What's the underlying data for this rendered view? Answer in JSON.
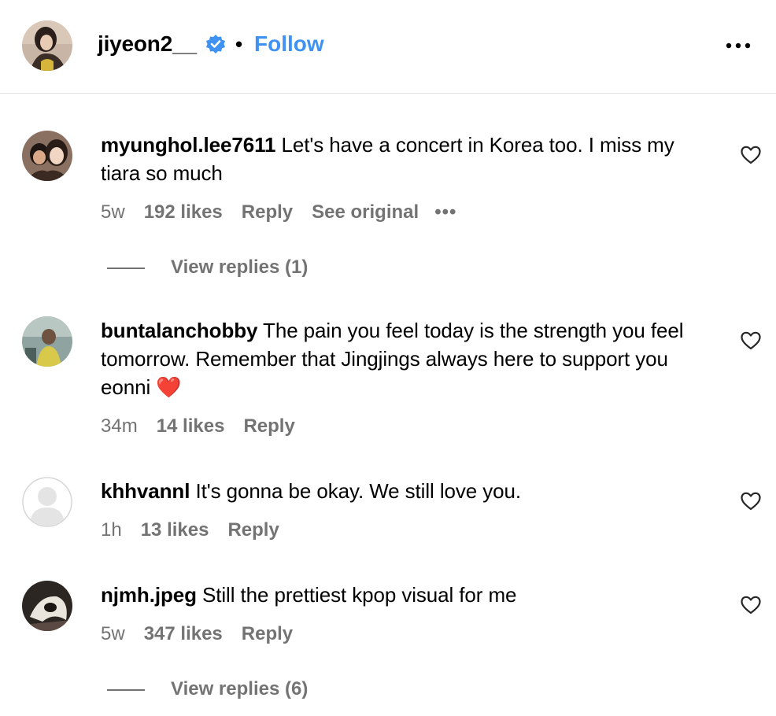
{
  "post_header": {
    "username": "jiyeon2__",
    "separator": "•",
    "follow_label": "Follow",
    "verified_icon": "verified-badge-icon",
    "more_icon": "more-options-icon",
    "accent_color": "#3f92f2"
  },
  "comments": [
    {
      "username": "myunghol.lee7611",
      "text": "Let's have a concert in Korea too. I miss my tiara so much",
      "time": "5w",
      "likes": "192 likes",
      "reply_label": "Reply",
      "see_original_label": "See original",
      "more_label": "•••",
      "view_replies_label": "View replies (1)"
    },
    {
      "username": "buntalanchobby",
      "text": "The pain you feel today is the strength you feel tomorrow. Remember that Jingjings always here to support you eonni ❤️",
      "time": "34m",
      "likes": "14 likes",
      "reply_label": "Reply"
    },
    {
      "username": "khhvannl",
      "text": "It's gonna be okay. We still love you.",
      "time": "1h",
      "likes": "13 likes",
      "reply_label": "Reply"
    },
    {
      "username": "njmh.jpeg",
      "text": "Still the prettiest kpop visual for me",
      "time": "5w",
      "likes": "347 likes",
      "reply_label": "Reply",
      "view_replies_label": "View replies (6)"
    }
  ],
  "colors": {
    "secondary_text": "#737373",
    "divider": "#e3e3e3"
  }
}
